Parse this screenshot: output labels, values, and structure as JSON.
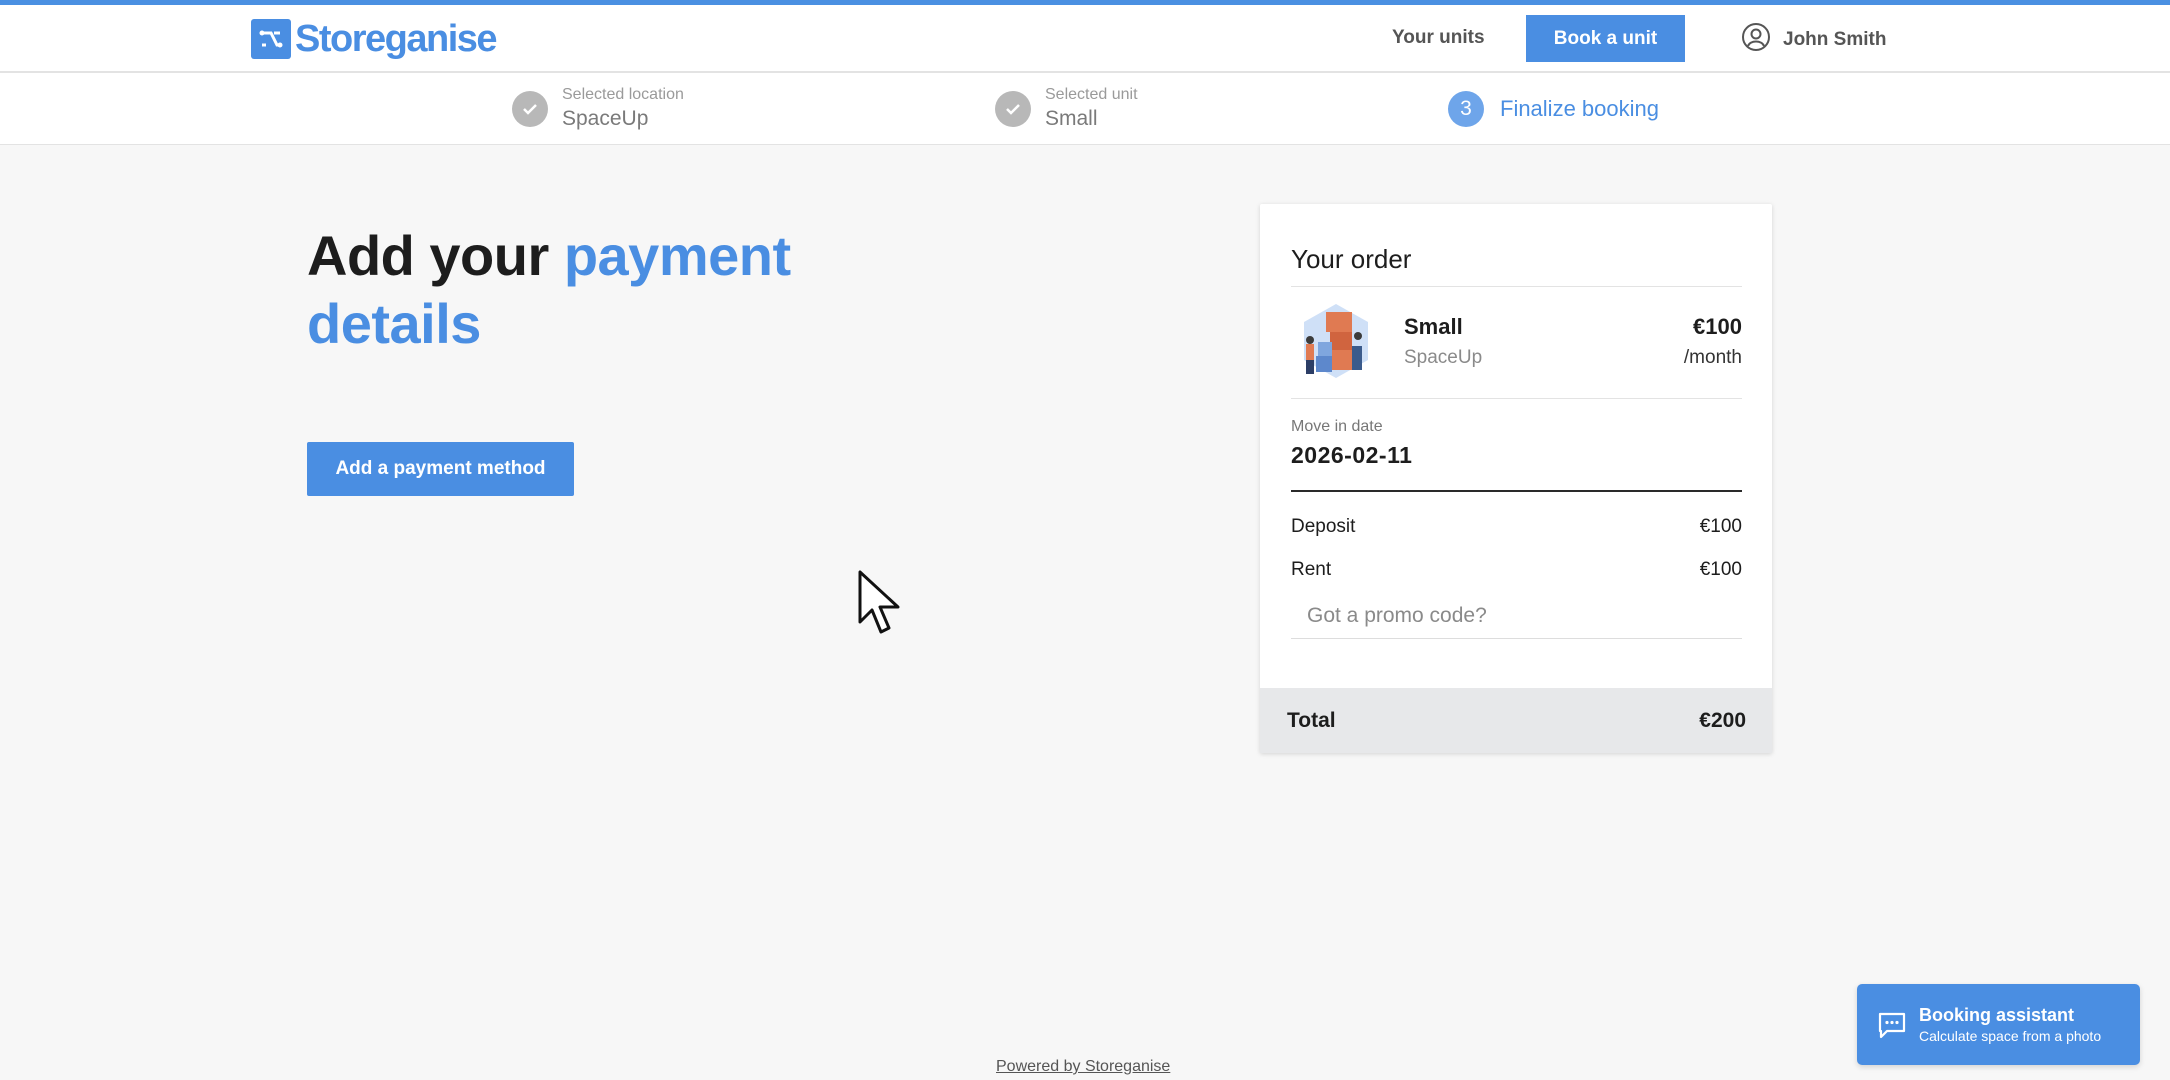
{
  "header": {
    "logo_text": "Storeganise",
    "nav_units": "Your units",
    "book_button": "Book a unit",
    "user_name": "John Smith"
  },
  "steps": [
    {
      "label": "Selected location",
      "value": "SpaceUp",
      "status": "done"
    },
    {
      "label": "Selected unit",
      "value": "Small",
      "status": "done"
    },
    {
      "number": "3",
      "label": "Finalize booking",
      "status": "active"
    }
  ],
  "main": {
    "title_part1": "Add your ",
    "title_part2": "payment",
    "title_part3": "details",
    "add_payment_button": "Add a payment method"
  },
  "order": {
    "title": "Your order",
    "unit_name": "Small",
    "unit_location": "SpaceUp",
    "unit_price": "€100",
    "unit_period": "/month",
    "move_in_label": "Move in date",
    "move_in_date": "2026-02-11",
    "deposit_label": "Deposit",
    "deposit_value": "€100",
    "rent_label": "Rent",
    "rent_value": "€100",
    "promo_placeholder": "Got a promo code?",
    "total_label": "Total",
    "total_value": "€200"
  },
  "footer": {
    "powered_by": "Powered by Storeganise"
  },
  "assistant": {
    "title": "Booking assistant",
    "subtitle": "Calculate space from a photo"
  },
  "colors": {
    "accent": "#4a8ee2",
    "background": "#f7f7f7",
    "step_done": "#b8b8b8",
    "total_bar": "#e7e8ea"
  },
  "icons": [
    "storeganise-logo-icon",
    "user-icon",
    "checkmark-icon",
    "chat-icon",
    "mouse-cursor-icon"
  ]
}
